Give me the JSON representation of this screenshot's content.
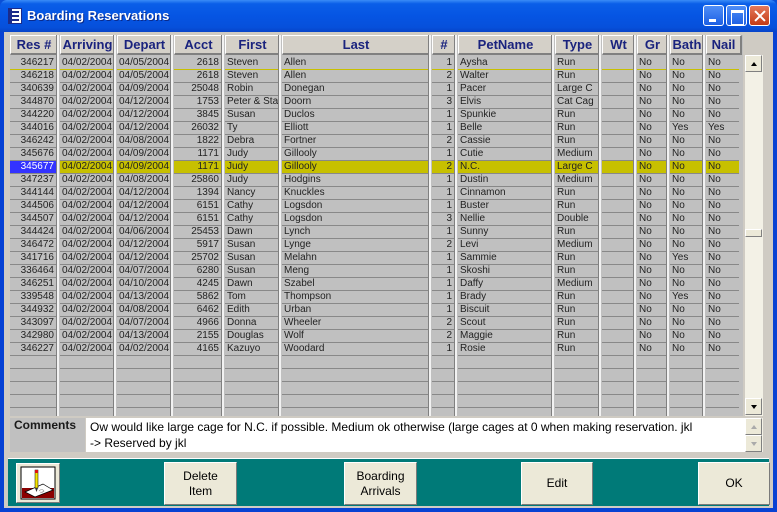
{
  "window": {
    "title": "Boarding Reservations",
    "title_icon": "form-icon",
    "controls": [
      "minimize-icon",
      "maximize-icon",
      "close-icon"
    ]
  },
  "grid": {
    "columns": [
      "Res #",
      "Arriving",
      "Depart",
      "Acct",
      "First",
      "Last",
      "#",
      "PetName",
      "Type",
      "Wt",
      "Gr",
      "Bath",
      "Nail"
    ],
    "selected_row_index": 8,
    "rows": [
      [
        "346217",
        "04/02/2004",
        "04/05/2004",
        "2618",
        "Steven",
        "Allen",
        "1",
        "Aysha",
        "Run",
        "",
        "No",
        "No",
        "No"
      ],
      [
        "346218",
        "04/02/2004",
        "04/05/2004",
        "2618",
        "Steven",
        "Allen",
        "2",
        "Walter",
        "Run",
        "",
        "No",
        "No",
        "No"
      ],
      [
        "340639",
        "04/02/2004",
        "04/09/2004",
        "25048",
        "Robin",
        "Donegan",
        "1",
        "Pacer",
        "Large C",
        "",
        "No",
        "No",
        "No"
      ],
      [
        "344870",
        "04/02/2004",
        "04/12/2004",
        "1753",
        "Peter & Sta",
        "Doorn",
        "3",
        "Elvis",
        "Cat Cag",
        "",
        "No",
        "No",
        "No"
      ],
      [
        "344220",
        "04/02/2004",
        "04/12/2004",
        "3845",
        "Susan",
        "Duclos",
        "1",
        "Spunkie",
        "Run",
        "",
        "No",
        "No",
        "No"
      ],
      [
        "344016",
        "04/02/2004",
        "04/12/2004",
        "26032",
        "Ty",
        "Elliott",
        "1",
        "Belle",
        "Run",
        "",
        "No",
        "Yes",
        "Yes"
      ],
      [
        "346242",
        "04/02/2004",
        "04/08/2004",
        "1822",
        "Debra",
        "Fortner",
        "2",
        "Cassie",
        "Run",
        "",
        "No",
        "No",
        "No"
      ],
      [
        "345676",
        "04/02/2004",
        "04/09/2004",
        "1171",
        "Judy",
        "Gillooly",
        "1",
        "Cutie",
        "Medium",
        "",
        "No",
        "No",
        "No"
      ],
      [
        "345677",
        "04/02/2004",
        "04/09/2004",
        "1171",
        "Judy",
        "Gillooly",
        "2",
        "N.C.",
        "Large C",
        "",
        "No",
        "No",
        "No"
      ],
      [
        "347237",
        "04/02/2004",
        "04/08/2004",
        "25860",
        "Judy",
        "Hodgins",
        "1",
        "Dustin",
        "Medium",
        "",
        "No",
        "No",
        "No"
      ],
      [
        "344144",
        "04/02/2004",
        "04/12/2004",
        "1394",
        "Nancy",
        "Knuckles",
        "1",
        "Cinnamon",
        "Run",
        "",
        "No",
        "No",
        "No"
      ],
      [
        "344506",
        "04/02/2004",
        "04/12/2004",
        "6151",
        "Cathy",
        "Logsdon",
        "1",
        "Buster",
        "Run",
        "",
        "No",
        "No",
        "No"
      ],
      [
        "344507",
        "04/02/2004",
        "04/12/2004",
        "6151",
        "Cathy",
        "Logsdon",
        "3",
        "Nellie",
        "Double",
        "",
        "No",
        "No",
        "No"
      ],
      [
        "344424",
        "04/02/2004",
        "04/06/2004",
        "25453",
        "Dawn",
        "Lynch",
        "1",
        "Sunny",
        "Run",
        "",
        "No",
        "No",
        "No"
      ],
      [
        "346472",
        "04/02/2004",
        "04/12/2004",
        "5917",
        "Susan",
        "Lynge",
        "2",
        "Levi",
        "Medium",
        "",
        "No",
        "No",
        "No"
      ],
      [
        "341716",
        "04/02/2004",
        "04/12/2004",
        "25702",
        "Susan",
        "Melahn",
        "1",
        "Sammie",
        "Run",
        "",
        "No",
        "Yes",
        "No"
      ],
      [
        "336464",
        "04/02/2004",
        "04/07/2004",
        "6280",
        "Susan",
        "Meng",
        "1",
        "Skoshi",
        "Run",
        "",
        "No",
        "No",
        "No"
      ],
      [
        "346251",
        "04/02/2004",
        "04/10/2004",
        "4245",
        "Dawn",
        "Szabel",
        "1",
        "Daffy",
        "Medium",
        "",
        "No",
        "No",
        "No"
      ],
      [
        "339548",
        "04/02/2004",
        "04/13/2004",
        "5862",
        "Tom",
        "Thompson",
        "1",
        "Brady",
        "Run",
        "",
        "No",
        "Yes",
        "No"
      ],
      [
        "344932",
        "04/02/2004",
        "04/08/2004",
        "6462",
        "Edith",
        "Urban",
        "1",
        "Biscuit",
        "Run",
        "",
        "No",
        "No",
        "No"
      ],
      [
        "343097",
        "04/02/2004",
        "04/07/2004",
        "4966",
        "Donna",
        "Wheeler",
        "2",
        "Scout",
        "Run",
        "",
        "No",
        "No",
        "No"
      ],
      [
        "342980",
        "04/02/2004",
        "04/13/2004",
        "2155",
        "Douglas",
        "Wolf",
        "2",
        "Maggie",
        "Run",
        "",
        "No",
        "No",
        "No"
      ],
      [
        "346227",
        "04/02/2004",
        "04/02/2004",
        "4165",
        "Kazuyo",
        "Woodard",
        "1",
        "Rosie",
        "Run",
        "",
        "No",
        "No",
        "No"
      ]
    ],
    "empty_rows": 4
  },
  "comments": {
    "label": "Comments",
    "text": "Ow would like large cage for N.C.  if possible.  Medium ok otherwise (large cages at 0 when making reservation.  jkl\n-> Reserved by jkl"
  },
  "footer": {
    "icon": "pencil-notepad-icon",
    "buttons": [
      {
        "id": "delete-item",
        "label": "Delete\nItem"
      },
      {
        "id": "boarding-arrivals",
        "label": "Boarding\nArrivals"
      },
      {
        "id": "edit",
        "label": "Edit"
      },
      {
        "id": "ok",
        "label": "OK"
      }
    ]
  },
  "colors": {
    "selection_highlight": "#c7c000",
    "selected_key_cell": "#3333ff",
    "footer_bg": "#007a78",
    "header_text": "#1a237e"
  }
}
